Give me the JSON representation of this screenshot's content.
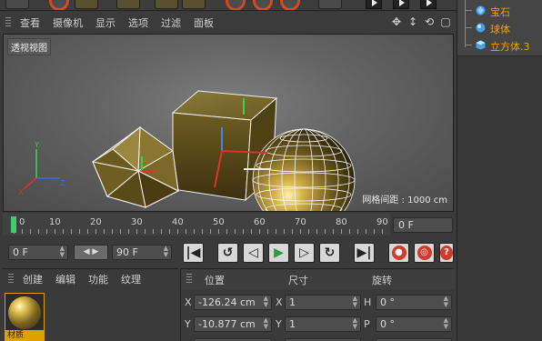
{
  "viewport": {
    "menu": [
      "查看",
      "摄像机",
      "显示",
      "选项",
      "过滤",
      "面板"
    ],
    "label": "透视视图",
    "grid_spacing": "网格间距 : 1000 cm"
  },
  "objects": [
    {
      "name": "宝石",
      "icon": "gem-icon"
    },
    {
      "name": "球体",
      "icon": "sphere-icon"
    },
    {
      "name": "立方体.3",
      "icon": "cube-icon"
    }
  ],
  "timeline": {
    "ticks": [
      "0",
      "10",
      "20",
      "30",
      "40",
      "50",
      "60",
      "70",
      "80",
      "90"
    ],
    "current_frame": "0 F"
  },
  "transport": {
    "start": "0 F",
    "end": "90 F"
  },
  "material": {
    "menu": [
      "创建",
      "编辑",
      "功能",
      "纹理"
    ],
    "swatch_name": "材质"
  },
  "coordinates": {
    "headers": [
      "位置",
      "尺寸",
      "旋转"
    ],
    "rows": [
      {
        "axis": "X",
        "pos": "-126.24 cm",
        "size_axis": "X",
        "size": "1",
        "rot_axis": "H",
        "rot": "0 °"
      },
      {
        "axis": "Y",
        "pos": "-10.877 cm",
        "size_axis": "Y",
        "size": "1",
        "rot_axis": "P",
        "rot": "0 °"
      }
    ]
  },
  "colors": {
    "accent": "#e0a000",
    "playhead": "#3fcf6a",
    "record": "#d23a2a"
  }
}
